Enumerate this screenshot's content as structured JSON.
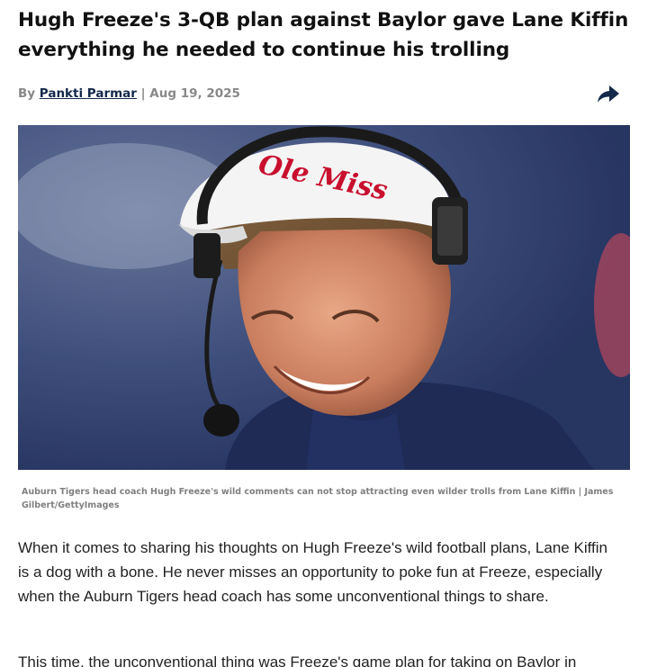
{
  "article": {
    "headline": "Hugh Freeze's 3-QB plan against Baylor gave Lane Kiffin everything he needed to continue his trolling",
    "byline_prefix": "By",
    "author": "Pankti Parmar",
    "separator": "|",
    "date": "Aug 19, 2025",
    "image_caption": "Auburn Tigers head coach Hugh Freeze's wild comments can not stop attracting even wilder trolls from Lane Kiffin | James Gilbert/GettyImages",
    "visor_logo": "Ole Miss",
    "paragraphs": [
      "When it comes to sharing his thoughts on Hugh Freeze's wild football plans, Lane Kiffin is a dog with a bone. He never misses an opportunity to poke fun at Freeze, especially when the Auburn Tigers head coach has some unconventional things to share.",
      "This time, the unconventional thing was Freeze's game plan for taking on Baylor in"
    ]
  },
  "icons": {
    "share": "share-arrow-icon"
  },
  "colors": {
    "author_link": "#13294b",
    "share_icon": "#13294b",
    "visor_logo": "#c8102e"
  }
}
